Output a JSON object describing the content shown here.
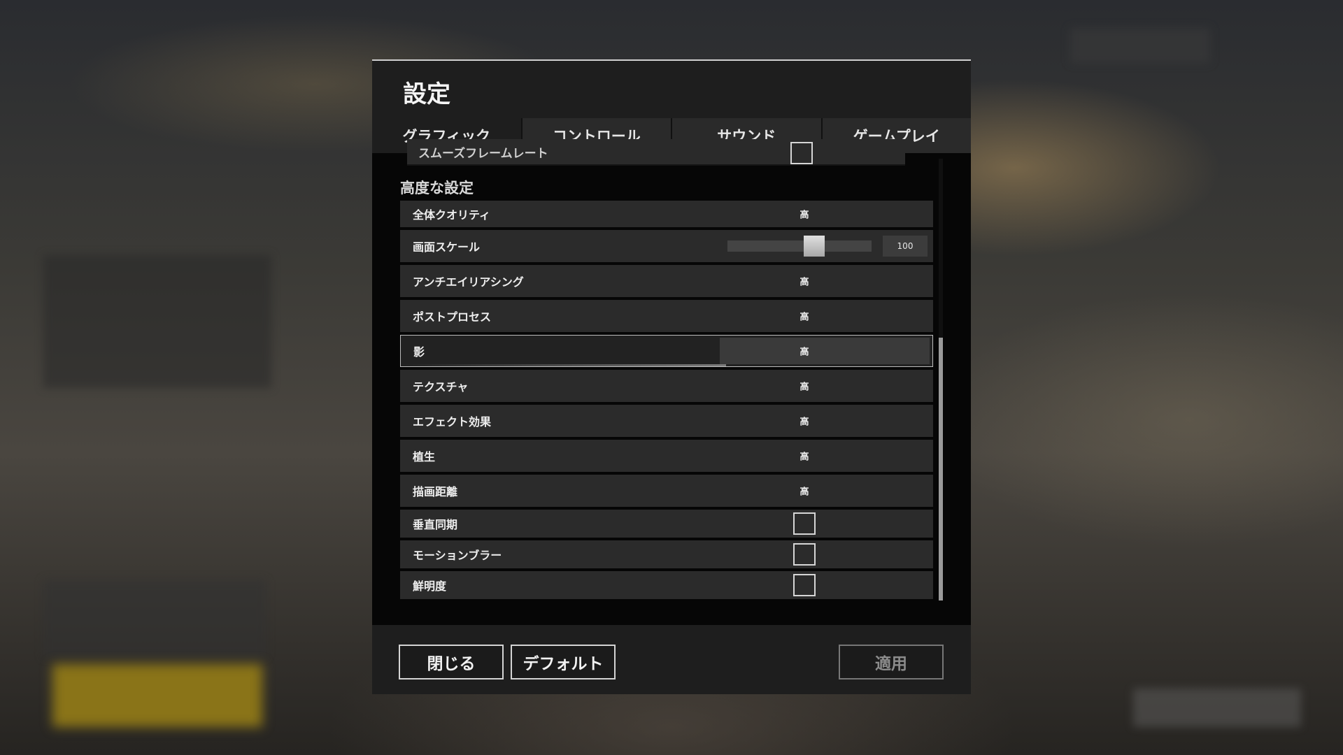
{
  "dialog": {
    "title": "設定",
    "tabs": [
      {
        "label": "グラフィック",
        "active": true
      },
      {
        "label": "コントロール",
        "active": false
      },
      {
        "label": "サウンド",
        "active": false
      },
      {
        "label": "ゲームプレイ",
        "active": false
      }
    ],
    "partial_row_label": "スムーズフレームレート",
    "section_title": "高度な設定",
    "rows": {
      "overall_quality": {
        "label": "全体クオリティ",
        "value": "高"
      },
      "screen_scale": {
        "label": "画面スケール",
        "value": "100",
        "slider_fraction": 0.6
      },
      "anti_aliasing": {
        "label": "アンチエイリアシング",
        "value": "高"
      },
      "post_process": {
        "label": "ポストプロセス",
        "value": "高"
      },
      "shadows": {
        "label": "影",
        "value": "高",
        "selected": true
      },
      "textures": {
        "label": "テクスチャ",
        "value": "高"
      },
      "effects": {
        "label": "エフェクト効果",
        "value": "高"
      },
      "foliage": {
        "label": "植生",
        "value": "高"
      },
      "view_distance": {
        "label": "描画距離",
        "value": "高"
      },
      "vsync": {
        "label": "垂直同期",
        "checked": false
      },
      "motion_blur": {
        "label": "モーションブラー",
        "checked": false
      },
      "sharpness": {
        "label": "鮮明度",
        "checked": false
      }
    },
    "footer": {
      "close_label": "閉じる",
      "default_label": "デフォルト",
      "apply_label": "適用",
      "apply_enabled": false
    }
  },
  "colors": {
    "dialog_bg": "#1e1e1e",
    "row_bg": "#2b2b2b",
    "content_bg": "#060606",
    "text": "#eeeeee",
    "disabled_text": "#8c8c8c"
  }
}
